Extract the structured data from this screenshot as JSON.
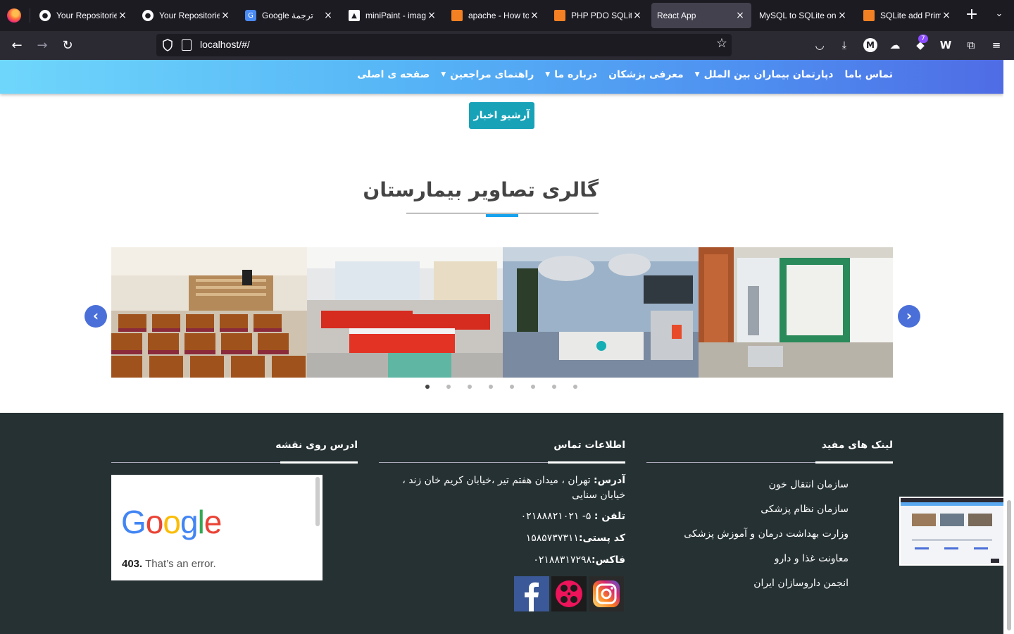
{
  "browser": {
    "tabs": [
      {
        "title": "Your Repositories",
        "icon": "github-icon",
        "active": false
      },
      {
        "title": "Your Repositories",
        "icon": "github-icon",
        "active": false
      },
      {
        "title": "Google ترجمة",
        "icon": "google-translate-icon",
        "active": false
      },
      {
        "title": "miniPaint - image editor",
        "icon": "minipaint-icon",
        "active": false
      },
      {
        "title": "apache - How to",
        "icon": "stackoverflow-icon",
        "active": false
      },
      {
        "title": "PHP PDO SQLite",
        "icon": "stackoverflow-icon",
        "active": false
      },
      {
        "title": "React App",
        "icon": "",
        "active": true
      },
      {
        "title": "MySQL to SQLite online",
        "icon": "",
        "active": false
      },
      {
        "title": "SQLite add Primary",
        "icon": "stackoverflow-icon",
        "active": false
      }
    ],
    "url": "localhost/#/",
    "badge_count": "7"
  },
  "site_nav": {
    "items": [
      {
        "label": "صفحه ی اصلی",
        "dropdown": false
      },
      {
        "label": "راهنمای مراجعین",
        "dropdown": true
      },
      {
        "label": "درباره ما",
        "dropdown": true
      },
      {
        "label": "معرفی پزشکان",
        "dropdown": false
      },
      {
        "label": "دپارتمان بیماران بین الملل",
        "dropdown": true
      },
      {
        "label": "تماس باما",
        "dropdown": false
      }
    ]
  },
  "archive_button": "آرشیو اخبار",
  "gallery": {
    "title": "گالری تصاویر بیمارستان",
    "slides": [
      "conference-hall",
      "patient-ward",
      "operating-room",
      "pharmacy"
    ],
    "dot_count": 8,
    "active_dot": 0,
    "prev_icon": "‹",
    "next_icon": "›"
  },
  "footer": {
    "links_heading": "لینک های مفید",
    "links": [
      "سازمان انتقال خون",
      "سازمان نظام پزشکی",
      "وزارت بهداشت درمان و آموزش پزشکی",
      "معاونت غذا و دارو",
      "انجمن داروسازان ایران"
    ],
    "contact_heading": "اطلاعات تماس",
    "address_label": "آدرس:",
    "address_value": "تهران ، میدان هفتم تیر ،خیابان کریم خان زند ، خیابان سنایی",
    "phone_label": "تلفن :",
    "phone_value": "۵- ۰۲۱۸۸۸۲۱۰۲۱",
    "postal_label": "کد پستی:",
    "postal_value": "۱۵۸۵۷۳۷۳۱۱",
    "fax_label": "فاکس:",
    "fax_value": "۰۲۱۸۸۳۱۷۲۹۸",
    "map_heading": "ادرس روی نقشه",
    "map_error_code": "403.",
    "map_error_text": "That’s an error.",
    "socials": [
      "facebook-icon",
      "aparat-icon",
      "instagram-icon"
    ]
  },
  "colors": {
    "nav_gradient_start": "#6fd6fb",
    "nav_gradient_end": "#4f6ce5",
    "archive_button": "#17a2b8",
    "footer_bg": "#263133",
    "accent": "#17a2ee"
  }
}
